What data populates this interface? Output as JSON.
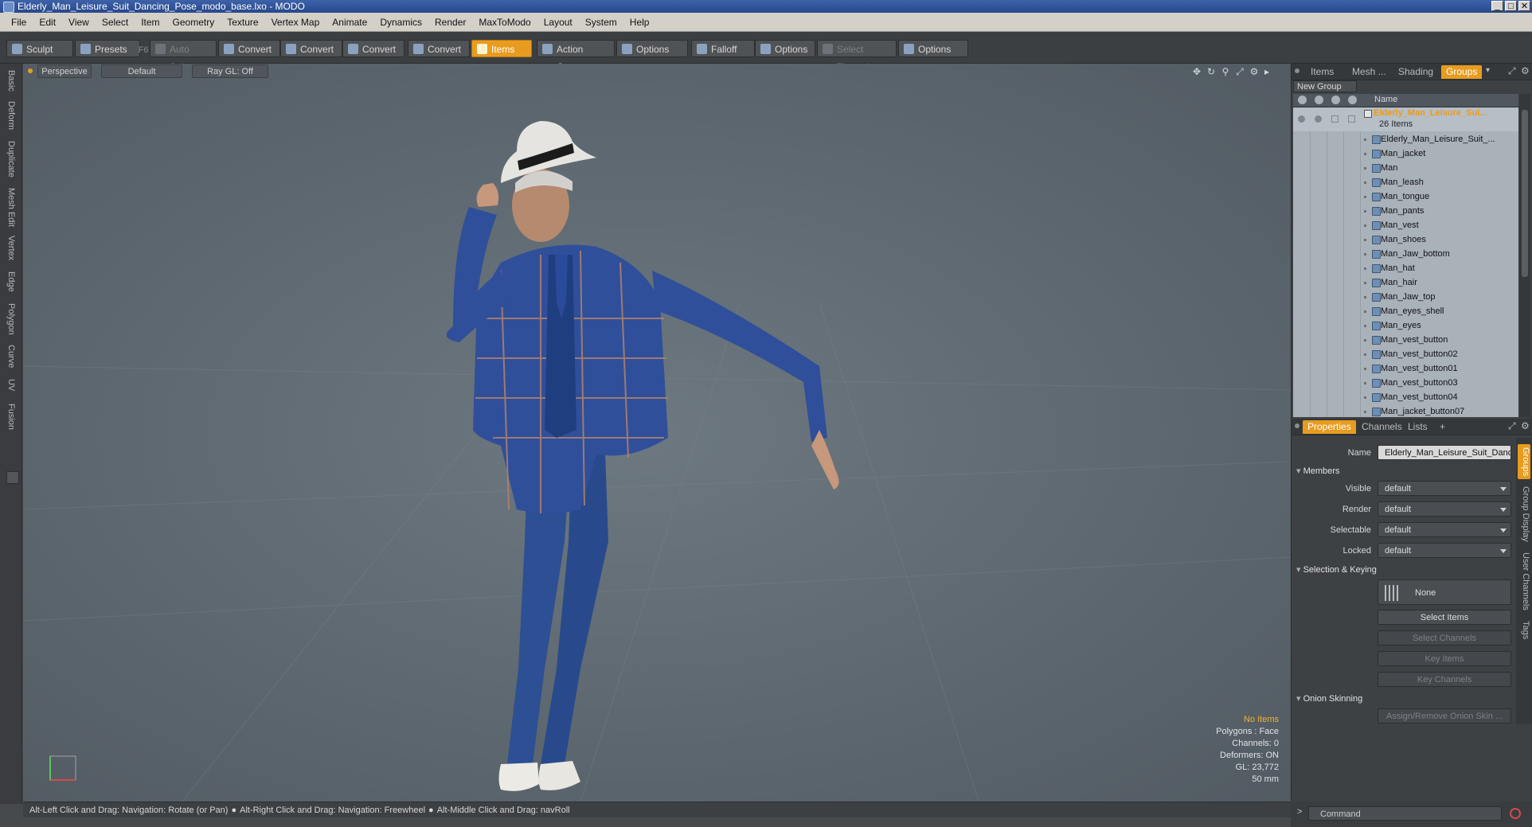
{
  "window": {
    "title": "Elderly_Man_Leisure_Suit_Dancing_Pose_modo_base.lxo - MODO"
  },
  "menu": [
    "File",
    "Edit",
    "View",
    "Select",
    "Item",
    "Geometry",
    "Texture",
    "Vertex Map",
    "Animate",
    "Dynamics",
    "Render",
    "MaxToModo",
    "Layout",
    "System",
    "Help"
  ],
  "toolbar": {
    "sculpt": "Sculpt",
    "presets": "Presets",
    "presets_hotkey": "F6",
    "auto_select": "Auto Select",
    "convert": "Convert",
    "items": "Items",
    "action_center": "Action Center",
    "options": "Options",
    "falloff": "Falloff",
    "select_through": "Select Through"
  },
  "left_tabs": [
    "Basic",
    "Deform",
    "Duplicate",
    "Mesh Edit",
    "Vertex",
    "Edge",
    "Polygon",
    "Curve",
    "UV",
    "Fusion"
  ],
  "viewport": {
    "view": "Perspective",
    "shading": "Default",
    "raygl": "Ray GL: Off",
    "info": {
      "items": "No Items",
      "polygons": "Polygons : Face",
      "channels": "Channels: 0",
      "deformers": "Deformers: ON",
      "gl": "GL: 23,772",
      "focal": "50 mm"
    }
  },
  "status": {
    "hint1": "Alt-Left Click and Drag: Navigation: Rotate (or Pan)",
    "hint2": "Alt-Right Click and Drag: Navigation: Freewheel",
    "hint3": "Alt-Middle Click and Drag: navRoll"
  },
  "panel_tabs": [
    "Items",
    "Mesh ...",
    "Shading",
    "Groups"
  ],
  "groups": {
    "new_group": "New Group",
    "column_name": "Name",
    "group_name": "Elderly_Man_Leisure_Sui...",
    "group_count": "26 Items",
    "items": [
      "Elderly_Man_Leisure_Suit_...",
      "Man_jacket",
      "Man",
      "Man_leash",
      "Man_tongue",
      "Man_pants",
      "Man_vest",
      "Man_shoes",
      "Man_Jaw_bottom",
      "Man_hat",
      "Man_hair",
      "Man_Jaw_top",
      "Man_eyes_shell",
      "Man_eyes",
      "Man_vest_button",
      "Man_vest_button02",
      "Man_vest_button01",
      "Man_vest_button03",
      "Man_vest_button04",
      "Man_jacket_button07"
    ]
  },
  "prop_tabs": [
    "Properties",
    "Channels",
    "Lists",
    "+"
  ],
  "properties": {
    "name_label": "Name",
    "name_value": "Elderly_Man_Leisure_Suit_Dancir",
    "members": "Members",
    "visible_label": "Visible",
    "render_label": "Render",
    "selectable_label": "Selectable",
    "locked_label": "Locked",
    "default": "default",
    "selection_keying": "Selection & Keying",
    "none": "None",
    "select_items": "Select Items",
    "select_channels": "Select Channels",
    "key_items": "Key Items",
    "key_channels": "Key Channels",
    "onion_skinning": "Onion Skinning",
    "assign_onion": "Assign/Remove Onion Skin ..."
  },
  "side_tabs": [
    "Groups",
    "Group Display",
    "User Channels",
    "Tags"
  ],
  "command": {
    "placeholder": "Command"
  },
  "colors": {
    "accent": "#e89c1f",
    "group_name": "#f09a14",
    "viewport_bg": "#5e6870"
  }
}
